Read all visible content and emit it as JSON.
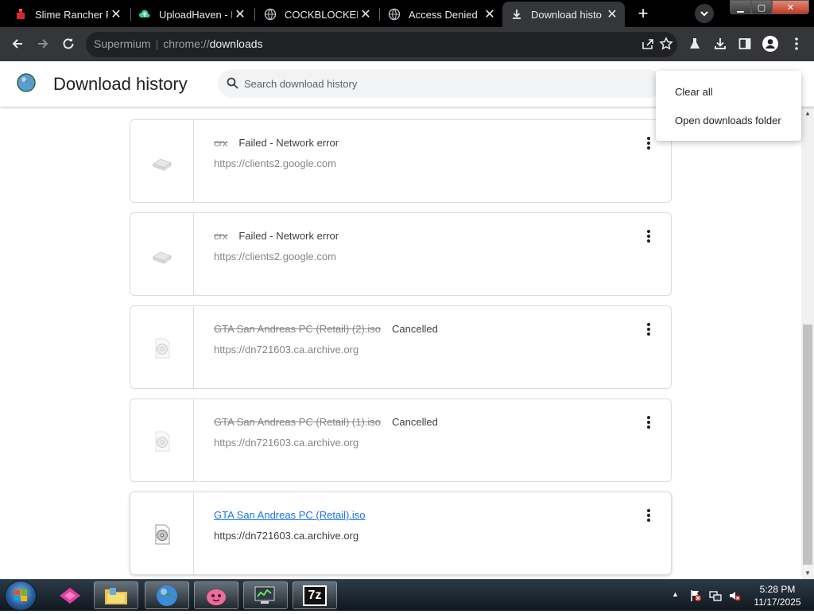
{
  "tabs": [
    {
      "title": "Slime Rancher Fr",
      "close": "✕"
    },
    {
      "title": "UploadHaven - F",
      "close": "✕"
    },
    {
      "title": "COCKBLOCKED",
      "close": "✕"
    },
    {
      "title": "Access Denied",
      "close": "✕"
    },
    {
      "title": "Download histo",
      "close": "✕"
    }
  ],
  "new_tab_label": "+",
  "window_buttons": {
    "minimize": "▁",
    "maximize": "▢",
    "close": "✕"
  },
  "omnibox": {
    "site": "Supermium",
    "separator": "|",
    "scheme": "chrome://",
    "host": "downloads"
  },
  "page": {
    "title": "Download history",
    "search_placeholder": "Search download history"
  },
  "menu": {
    "items": [
      "Clear all",
      "Open downloads folder"
    ]
  },
  "downloads": [
    {
      "filename": "crx",
      "status": "Failed - Network error",
      "url": "https://clients2.google.com",
      "icon": "network-error-icon"
    },
    {
      "filename": "crx",
      "status": "Failed - Network error",
      "url": "https://clients2.google.com",
      "icon": "network-error-icon"
    },
    {
      "filename": "GTA San Andreas PC (Retail) (2).iso",
      "status": "Cancelled",
      "url": "https://dn721603.ca.archive.org",
      "icon": "disc-file-icon"
    },
    {
      "filename": "GTA San Andreas PC (Retail) (1).iso",
      "status": "Cancelled",
      "url": "https://dn721603.ca.archive.org",
      "icon": "disc-file-icon"
    },
    {
      "filename": "GTA San Andreas PC (Retail).iso",
      "status": "",
      "url": "https://dn721603.ca.archive.org",
      "icon": "disc-file-icon"
    }
  ],
  "taskbar": {
    "apps": [
      "media-center-icon",
      "file-explorer-icon",
      "browser-icon",
      "slime-game-icon",
      "system-monitor-icon",
      "7zip-icon"
    ],
    "seven_zip_label": "7z",
    "tray_arrow": "▲",
    "time": "5:28 PM",
    "date": "11/17/2025"
  },
  "colors": {
    "tab_strip": "#000000",
    "toolbar": "#35363a",
    "link": "#1a73e8",
    "taskbar": "#1a2530"
  }
}
